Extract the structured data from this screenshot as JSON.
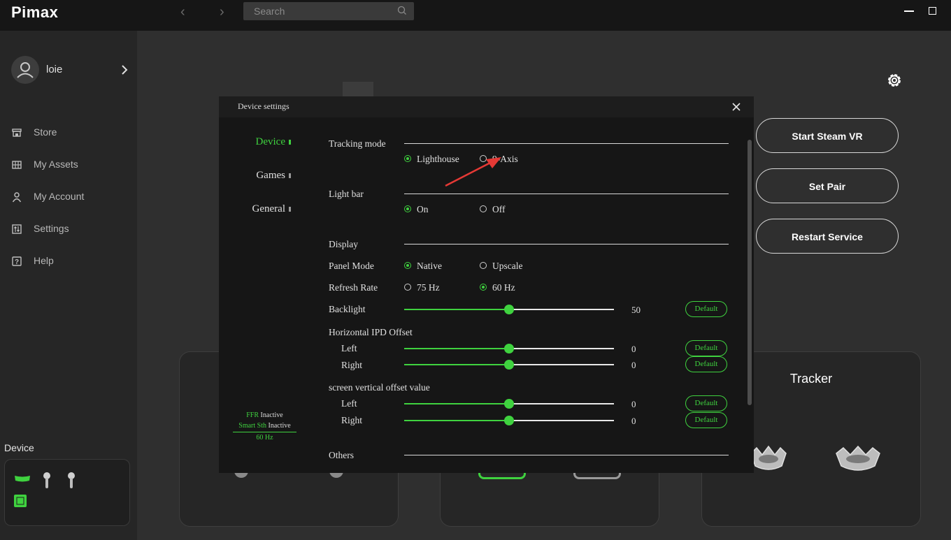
{
  "app": {
    "logo": "Pimax"
  },
  "search": {
    "placeholder": "Search"
  },
  "user": {
    "name": "loie"
  },
  "sidebar": {
    "items": [
      {
        "label": "Store",
        "icon": "store-icon"
      },
      {
        "label": "My Assets",
        "icon": "grid-icon"
      },
      {
        "label": "My Account",
        "icon": "person-icon"
      },
      {
        "label": "Settings",
        "icon": "sliders-icon"
      },
      {
        "label": "Help",
        "icon": "help-icon"
      }
    ],
    "device_heading": "Device"
  },
  "actions": {
    "start_steam_vr": "Start Steam VR",
    "set_pair": "Set Pair",
    "restart_service": "Restart Service"
  },
  "cards": {
    "tracker_title": "Tracker"
  },
  "dialog": {
    "title": "Device settings",
    "tabs": [
      {
        "label": "Device",
        "active": true
      },
      {
        "label": "Games",
        "active": false
      },
      {
        "label": "General",
        "active": false
      }
    ],
    "tracking_mode": {
      "label": "Tracking mode",
      "options": [
        "Lighthouse",
        "9-Axis"
      ],
      "selected": "Lighthouse"
    },
    "light_bar": {
      "label": "Light bar",
      "options": [
        "On",
        "Off"
      ],
      "selected": "On"
    },
    "display": {
      "label": "Display",
      "panel_mode": {
        "label": "Panel Mode",
        "options": [
          "Native",
          "Upscale"
        ],
        "selected": "Native"
      },
      "refresh_rate": {
        "label": "Refresh Rate",
        "options": [
          "75 Hz",
          "60 Hz"
        ],
        "selected": "60 Hz"
      },
      "backlight": {
        "label": "Backlight",
        "value": "50",
        "fraction": 0.5,
        "default_label": "Default"
      }
    },
    "ipd_offset": {
      "label": "Horizontal IPD Offset",
      "left": {
        "label": "Left",
        "value": "0",
        "fraction": 0.5
      },
      "right": {
        "label": "Right",
        "value": "0",
        "fraction": 0.5
      },
      "default_label": "Default"
    },
    "vertical_offset": {
      "label": "screen vertical offset value",
      "left": {
        "label": "Left",
        "value": "0",
        "fraction": 0.5
      },
      "right": {
        "label": "Right",
        "value": "0",
        "fraction": 0.5
      },
      "default_label": "Default"
    },
    "others": {
      "label": "Others"
    },
    "status": {
      "ffr_key": "FFR",
      "ffr_value": "Inactive",
      "smart_key": "Smart Sth",
      "smart_value": "Inactive",
      "refresh": "60 Hz"
    }
  },
  "colors": {
    "accent": "#3fd23f",
    "background": "#2f2f2f",
    "titlebar": "#161616",
    "dialog": "#161616",
    "annotation_arrow": "#e53935"
  }
}
